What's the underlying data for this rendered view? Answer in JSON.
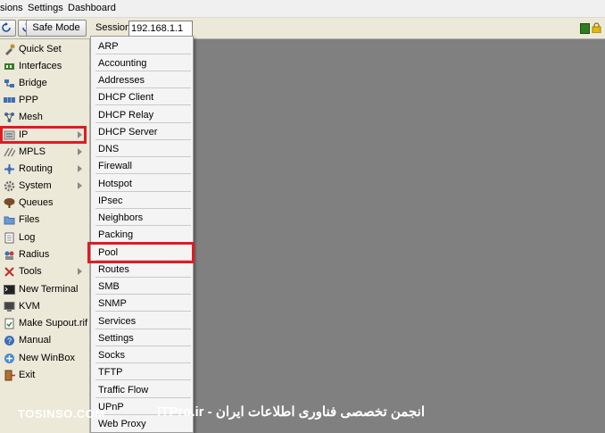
{
  "menubar": {
    "items": [
      "sions",
      "Settings",
      "Dashboard"
    ]
  },
  "toolbar": {
    "refresh_icon": "refresh-icon",
    "safe_mode_label": "Safe Mode",
    "session_label": "Session:",
    "session_value": "192.168.1.1",
    "status_colors": {
      "connected": "#2e7d1e",
      "lock": "#e0b000"
    }
  },
  "sidebar": {
    "items": [
      {
        "label": "Quick Set",
        "icon": "quick-set-icon"
      },
      {
        "label": "Interfaces",
        "icon": "interfaces-icon"
      },
      {
        "label": "Bridge",
        "icon": "bridge-icon"
      },
      {
        "label": "PPP",
        "icon": "ppp-icon"
      },
      {
        "label": "Mesh",
        "icon": "mesh-icon"
      },
      {
        "label": "IP",
        "icon": "ip-icon",
        "has_submenu": true,
        "highlighted": true
      },
      {
        "label": "MPLS",
        "icon": "mpls-icon",
        "has_submenu": true
      },
      {
        "label": "Routing",
        "icon": "routing-icon",
        "has_submenu": true
      },
      {
        "label": "System",
        "icon": "system-icon",
        "has_submenu": true
      },
      {
        "label": "Queues",
        "icon": "queues-icon"
      },
      {
        "label": "Files",
        "icon": "files-icon"
      },
      {
        "label": "Log",
        "icon": "log-icon"
      },
      {
        "label": "Radius",
        "icon": "radius-icon"
      },
      {
        "label": "Tools",
        "icon": "tools-icon",
        "has_submenu": true
      },
      {
        "label": "New Terminal",
        "icon": "terminal-icon"
      },
      {
        "label": "KVM",
        "icon": "kvm-icon"
      },
      {
        "label": "Make Supout.rif",
        "icon": "supout-icon"
      },
      {
        "label": "Manual",
        "icon": "manual-icon"
      },
      {
        "label": "New WinBox",
        "icon": "winbox-icon"
      },
      {
        "label": "Exit",
        "icon": "exit-icon"
      }
    ]
  },
  "ip_submenu": {
    "items": [
      "ARP",
      "Accounting",
      "Addresses",
      "DHCP Client",
      "DHCP Relay",
      "DHCP Server",
      "DNS",
      "Firewall",
      "Hotspot",
      "IPsec",
      "Neighbors",
      "Packing",
      "Pool",
      "Routes",
      "SMB",
      "SNMP",
      "Services",
      "Settings",
      "Socks",
      "TFTP",
      "Traffic Flow",
      "UPnP",
      "Web Proxy"
    ],
    "highlighted": "Pool"
  },
  "watermark": {
    "left": "TOSINSO.COM",
    "right": "ITPro.ir - انجمن تخصصی فناوری اطلاعات ایران"
  },
  "colors": {
    "highlight": "#e01b24",
    "workspace": "#808080"
  }
}
